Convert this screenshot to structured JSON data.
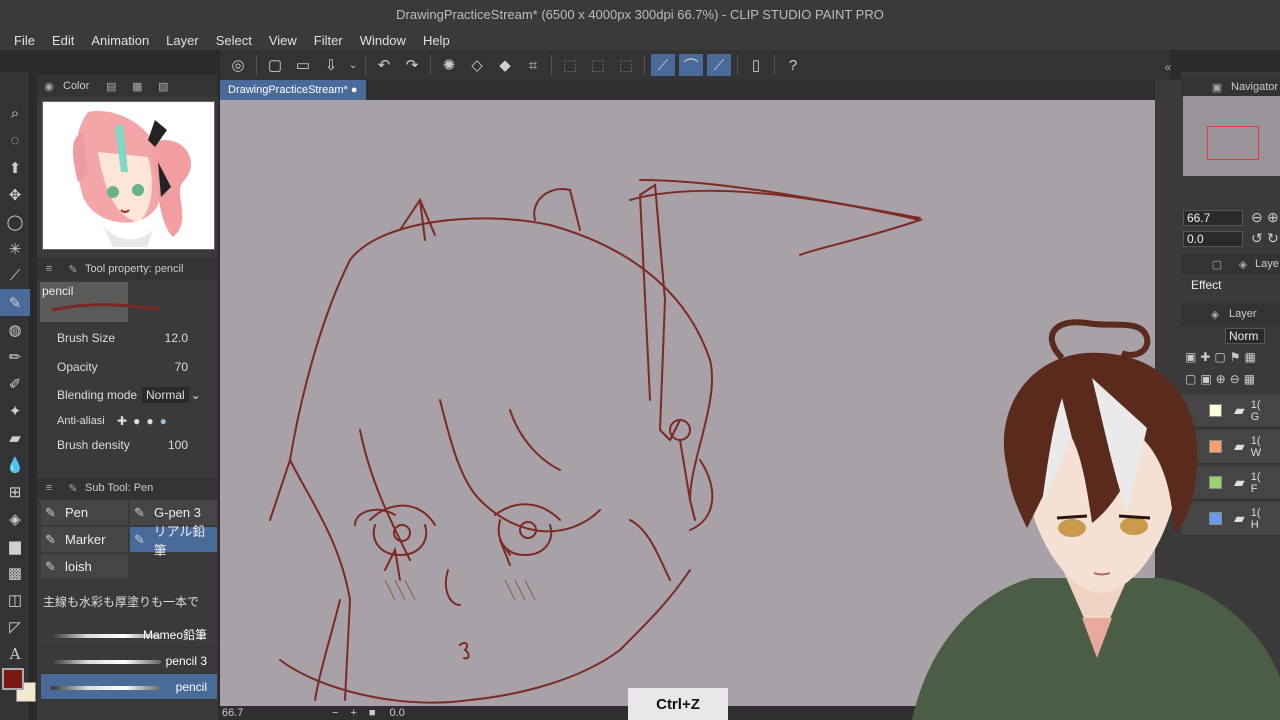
{
  "titlebar": {
    "text": "DrawingPracticeStream* (6500 x 4000px 300dpi 66.7%)  - CLIP STUDIO PAINT PRO"
  },
  "menu": [
    "File",
    "Edit",
    "Animation",
    "Layer",
    "Select",
    "View",
    "Filter",
    "Window",
    "Help"
  ],
  "document_tab": {
    "label": "DrawingPracticeStream*"
  },
  "left_panel": {
    "color_tab": {
      "label": "Color"
    },
    "tool_property": {
      "title": "Tool property: pencil",
      "preset_name": "pencil",
      "brush_size": {
        "label": "Brush Size",
        "value": "12.0"
      },
      "opacity": {
        "label": "Opacity",
        "value": "70"
      },
      "blending_mode": {
        "label": "Blending mode",
        "value": "Normal"
      },
      "anti_aliasing": {
        "label": "Anti-aliasi"
      },
      "brush_density": {
        "label": "Brush density",
        "value": "100"
      }
    },
    "sub_tool": {
      "title": "Sub Tool: Pen",
      "items": [
        {
          "label": "Pen",
          "selected": false
        },
        {
          "label": "G-pen 3",
          "selected": false
        },
        {
          "label": "Marker",
          "selected": false
        },
        {
          "label": "リアル鉛筆",
          "selected": true
        },
        {
          "label": "loish",
          "selected": false
        }
      ],
      "brush_header": "主線も水彩も厚塗りも一本で",
      "brushes": [
        {
          "label": "Mameo鉛筆",
          "selected": false
        },
        {
          "label": "pencil 3",
          "selected": false
        },
        {
          "label": "pencil",
          "selected": true
        }
      ]
    }
  },
  "right_panel": {
    "navigator": {
      "label": "Navigator",
      "zoom": "66.7",
      "rotation": "0.0"
    },
    "layer_property_tab": {
      "label": "Laye"
    },
    "effect": {
      "label": "Effect"
    },
    "layer_tab": {
      "label": "Layer"
    },
    "blend_mode": {
      "value": "Norm"
    },
    "layers": [
      {
        "label": "1(",
        "sub": "G"
      },
      {
        "label": "1(",
        "sub": "W"
      },
      {
        "label": "1(",
        "sub": "F"
      },
      {
        "label": "1(",
        "sub": "H"
      }
    ]
  },
  "status": {
    "zoom": "66.7",
    "rotation": "0.0"
  },
  "overlay": {
    "shortcut": "Ctrl+Z"
  },
  "colors": {
    "main_color": "#7a1a14",
    "sub_color": "#f5e8d0",
    "accent": "#4a6a9a",
    "canvas_bg": "#a8a1a7",
    "line_color": "#7d2a22"
  }
}
